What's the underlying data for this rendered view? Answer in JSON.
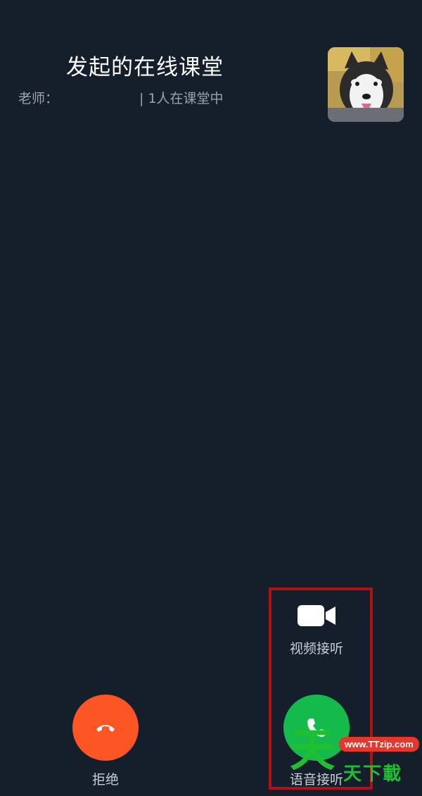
{
  "header": {
    "title": "发起的在线课堂",
    "teacher_label": "老师：",
    "attendance": "| 1人在课堂中"
  },
  "avatar": {
    "icon": "dog-avatar-image"
  },
  "actions": {
    "video_answer_label": "视频接听",
    "reject_label": "拒绝",
    "voice_answer_label": "语音接听"
  },
  "colors": {
    "background": "#151e2b",
    "reject": "#fd5523",
    "answer": "#14bb4c",
    "highlight": "#b3110f"
  },
  "watermark": {
    "big_char": "天",
    "url": "www.TTzip.com",
    "text": "天下載"
  }
}
